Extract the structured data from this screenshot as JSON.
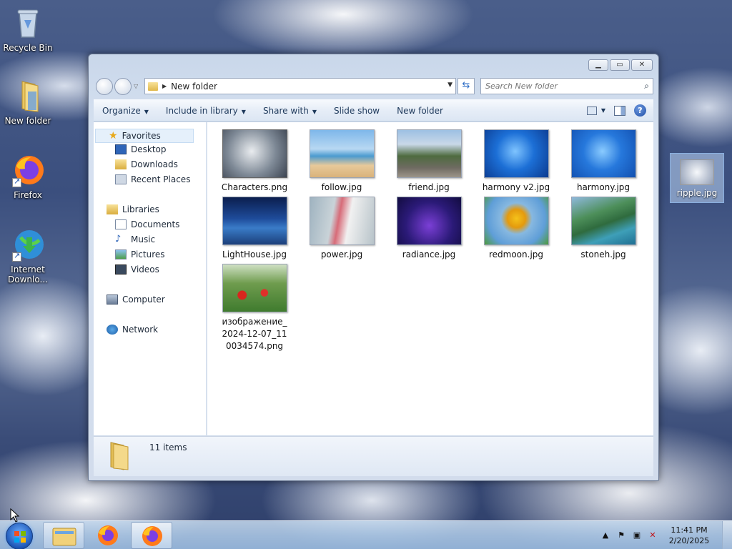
{
  "desktop": {
    "icons": [
      {
        "label": "Recycle Bin"
      },
      {
        "label": "New folder"
      },
      {
        "label": "Firefox"
      },
      {
        "label_line1": "Internet",
        "label_line2": "Downlo..."
      }
    ],
    "dragged_item": {
      "label": "ripple.jpg"
    }
  },
  "window": {
    "address": {
      "crumb": "New folder"
    },
    "search": {
      "placeholder": "Search New folder"
    },
    "toolbar": {
      "organize": "Organize",
      "include_in_library": "Include in library",
      "share_with": "Share with",
      "slide_show": "Slide show",
      "new_folder": "New folder"
    },
    "nav": {
      "favorites": "Favorites",
      "desktop": "Desktop",
      "downloads": "Downloads",
      "recent_places": "Recent Places",
      "libraries": "Libraries",
      "documents": "Documents",
      "music": "Music",
      "pictures": "Pictures",
      "videos": "Videos",
      "computer": "Computer",
      "network": "Network"
    },
    "files": [
      {
        "name": "Characters.png"
      },
      {
        "name": "follow.jpg"
      },
      {
        "name": "friend.jpg"
      },
      {
        "name": "harmony v2.jpg"
      },
      {
        "name": "harmony.jpg"
      },
      {
        "name": "LightHouse.jpg"
      },
      {
        "name": "power.jpg"
      },
      {
        "name": "radiance.jpg"
      },
      {
        "name": "redmoon.jpg"
      },
      {
        "name": "stoneh.jpg"
      },
      {
        "name": "изображение_2024-12-07_110034574.png"
      }
    ],
    "status": {
      "item_count": "11 items"
    }
  },
  "taskbar": {
    "clock": {
      "time": "11:41 PM",
      "date": "2/20/2025"
    }
  },
  "colors": {
    "accent": "#1c56b6",
    "toolbar_text": "#1e395b"
  }
}
